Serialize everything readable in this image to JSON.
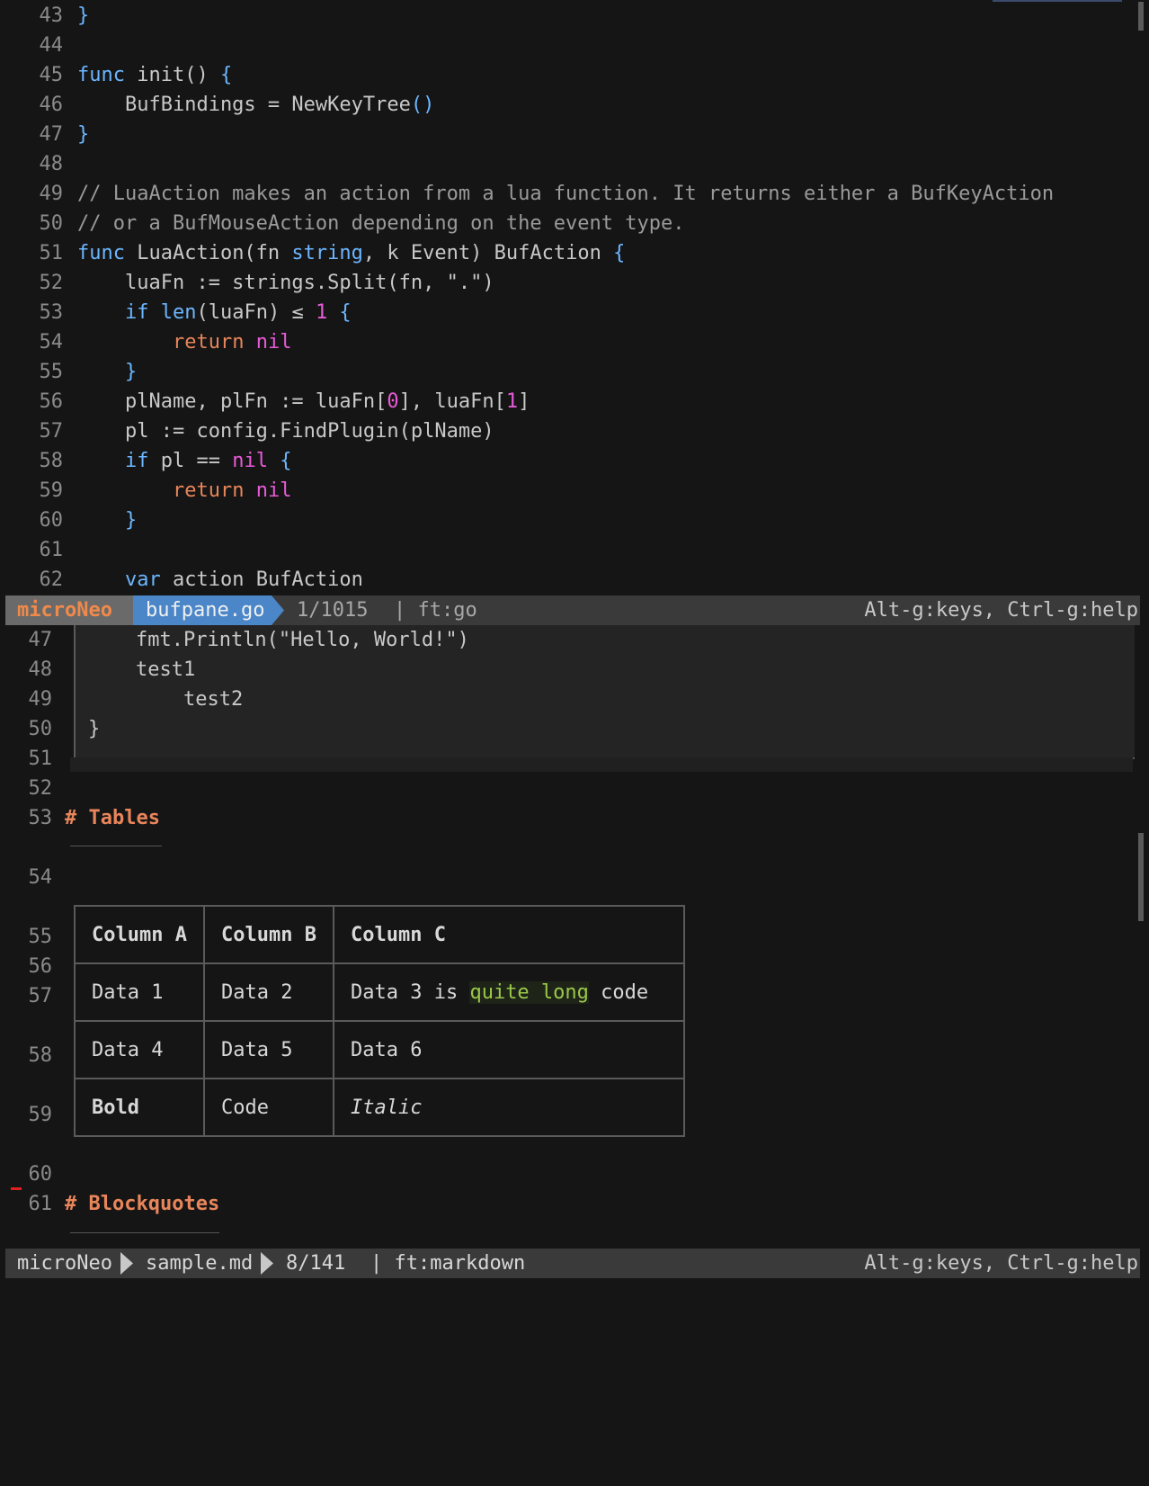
{
  "colors": {
    "background": "#151515",
    "keyword": "#6cb6ff",
    "return": "#e8855a",
    "nil": "#e85ad8",
    "status_bg": "#3a3a3a",
    "active_name_bg": "#6a6a6a",
    "active_file_bg": "#4a86c8",
    "heading": "#e8855a",
    "inline_code": "#9ac84a"
  },
  "top_pane": {
    "lines": [
      {
        "n": "43",
        "parts": [
          {
            "t": "}",
            "c": "br"
          }
        ]
      },
      {
        "n": "44",
        "parts": []
      },
      {
        "n": "45",
        "parts": [
          {
            "t": "func",
            "c": "kw"
          },
          {
            "t": " init",
            "c": ""
          },
          {
            "t": "()",
            "c": ""
          },
          {
            "t": " {",
            "c": "br"
          }
        ]
      },
      {
        "n": "46",
        "parts": [
          {
            "t": "    BufBindings = NewKeyTree",
            "c": ""
          },
          {
            "t": "()",
            "c": "br"
          }
        ]
      },
      {
        "n": "47",
        "parts": [
          {
            "t": "}",
            "c": "br"
          }
        ]
      },
      {
        "n": "48",
        "parts": []
      },
      {
        "n": "49",
        "parts": [
          {
            "t": "// LuaAction makes an action from a lua function. It returns either a BufKeyAction",
            "c": "cm"
          }
        ]
      },
      {
        "n": "50",
        "parts": [
          {
            "t": "// or a BufMouseAction depending on the event type.",
            "c": "cm"
          }
        ]
      },
      {
        "n": "51",
        "parts": [
          {
            "t": "func",
            "c": "kw"
          },
          {
            "t": " LuaAction(fn ",
            "c": ""
          },
          {
            "t": "string",
            "c": "ty"
          },
          {
            "t": ", k Event) BufAction ",
            "c": ""
          },
          {
            "t": "{",
            "c": "br"
          }
        ]
      },
      {
        "n": "52",
        "parts": [
          {
            "t": "    luaFn := strings.Split(fn, \".\")",
            "c": ""
          }
        ]
      },
      {
        "n": "53",
        "parts": [
          {
            "t": "    ",
            "c": ""
          },
          {
            "t": "if",
            "c": "kw"
          },
          {
            "t": " ",
            "c": ""
          },
          {
            "t": "len",
            "c": "kw"
          },
          {
            "t": "(luaFn) ≤ ",
            "c": ""
          },
          {
            "t": "1",
            "c": "num"
          },
          {
            "t": " {",
            "c": "br"
          }
        ]
      },
      {
        "n": "54",
        "parts": [
          {
            "t": "        ",
            "c": ""
          },
          {
            "t": "return",
            "c": "ret"
          },
          {
            "t": " ",
            "c": ""
          },
          {
            "t": "nil",
            "c": "nil"
          }
        ]
      },
      {
        "n": "55",
        "parts": [
          {
            "t": "    }",
            "c": "br"
          }
        ]
      },
      {
        "n": "56",
        "parts": [
          {
            "t": "    plName, plFn := luaFn[",
            "c": ""
          },
          {
            "t": "0",
            "c": "num"
          },
          {
            "t": "], luaFn[",
            "c": ""
          },
          {
            "t": "1",
            "c": "num"
          },
          {
            "t": "]",
            "c": ""
          }
        ]
      },
      {
        "n": "57",
        "parts": [
          {
            "t": "    pl := config.FindPlugin(plName)",
            "c": ""
          }
        ]
      },
      {
        "n": "58",
        "parts": [
          {
            "t": "    ",
            "c": ""
          },
          {
            "t": "if",
            "c": "kw"
          },
          {
            "t": " pl == ",
            "c": ""
          },
          {
            "t": "nil",
            "c": "nil"
          },
          {
            "t": " {",
            "c": "br"
          }
        ]
      },
      {
        "n": "59",
        "parts": [
          {
            "t": "        ",
            "c": ""
          },
          {
            "t": "return",
            "c": "ret"
          },
          {
            "t": " ",
            "c": ""
          },
          {
            "t": "nil",
            "c": "nil"
          }
        ]
      },
      {
        "n": "60",
        "parts": [
          {
            "t": "    }",
            "c": "br"
          }
        ]
      },
      {
        "n": "61",
        "parts": []
      },
      {
        "n": "62",
        "parts": [
          {
            "t": "    ",
            "c": ""
          },
          {
            "t": "var",
            "c": "kw"
          },
          {
            "t": " action BufAction",
            "c": ""
          }
        ]
      }
    ]
  },
  "top_status": {
    "name": "microNeo",
    "file": "bufpane.go",
    "position": "1/1015",
    "filetype": "| ft:go",
    "help": "Alt-g:keys, Ctrl-g:help"
  },
  "bottom_pane": {
    "code_lines": [
      {
        "n": "47",
        "text": "    fmt.Println(\"Hello, World!\")"
      },
      {
        "n": "48",
        "text": "    test1"
      },
      {
        "n": "49",
        "text": "        test2"
      },
      {
        "n": "50",
        "text": "}"
      }
    ],
    "empty_lines": [
      "51",
      "52",
      "54",
      "60"
    ],
    "headings": [
      {
        "n": "53",
        "text": "# Tables"
      },
      {
        "n": "61",
        "text": "# Blockquotes"
      }
    ],
    "table": {
      "row_numbers": [
        "55",
        "56",
        "57",
        "58",
        "59"
      ],
      "headers": [
        "Column A",
        "Column B",
        "Column C"
      ],
      "rows": [
        [
          "Data 1",
          "Data 2",
          "Data 3 is "
        ],
        [
          "Data 4",
          "Data 5",
          "Data 6"
        ],
        [
          "Bold",
          "Code",
          "Italic"
        ]
      ],
      "inline_code": "quite long",
      "after_code": " code"
    }
  },
  "bottom_status": {
    "name": "microNeo",
    "file": "sample.md",
    "position": "8/141",
    "filetype": "| ft:markdown",
    "help": "Alt-g:keys, Ctrl-g:help"
  }
}
